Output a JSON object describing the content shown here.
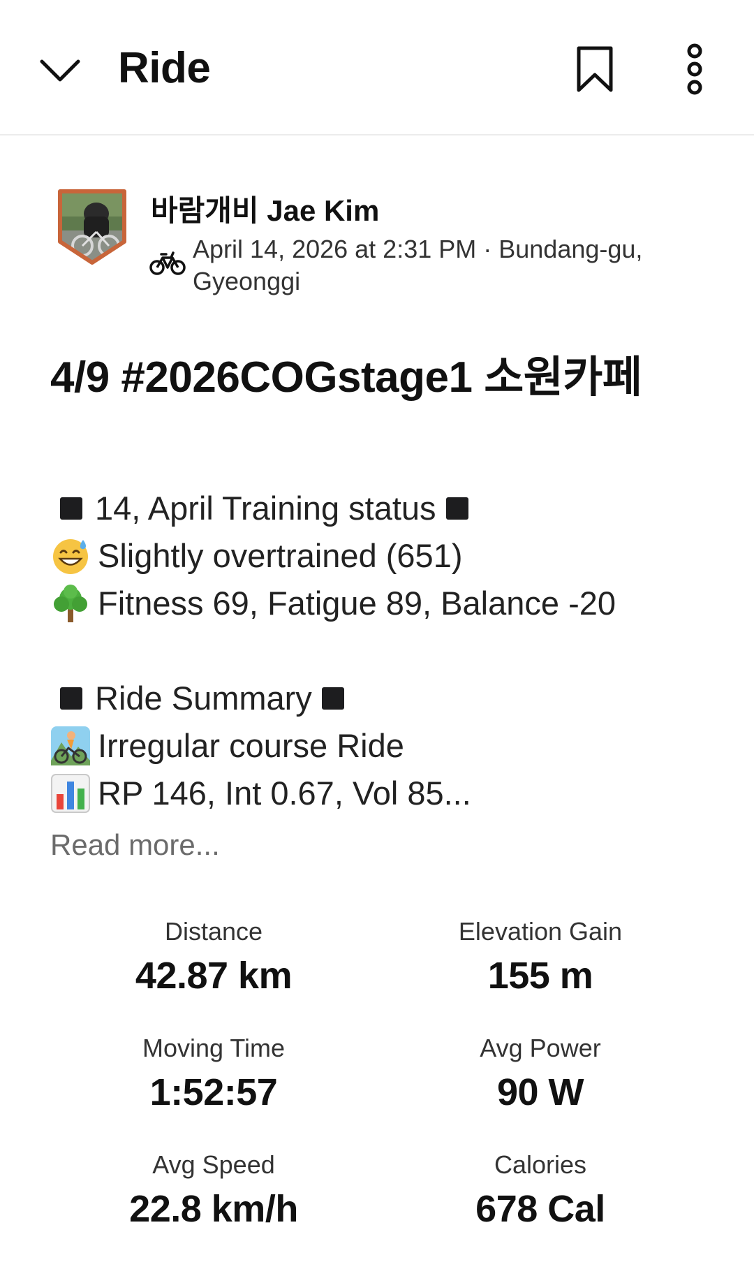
{
  "header": {
    "title": "Ride"
  },
  "athlete": {
    "name": "바람개비 Jae Kim",
    "activity_meta": "April 14, 2026 at 2:31 PM · Bundang-gu, Gyeonggi"
  },
  "activity": {
    "title": "4/9 #2026COGstage1 소원카페",
    "description": {
      "training_status_header": "14, April Training status",
      "status_line": "Slightly overtrained (651)",
      "fitness_line": "Fitness 69, Fatigue 89, Balance -20",
      "ride_summary_header": "Ride Summary",
      "course_line": "Irregular course Ride",
      "metrics_line": "RP 146, Int 0.67, Vol 85..."
    },
    "read_more": "Read more..."
  },
  "stats": [
    {
      "label": "Distance",
      "value": "42.87 km"
    },
    {
      "label": "Elevation Gain",
      "value": "155 m"
    },
    {
      "label": "Moving Time",
      "value": "1:52:57"
    },
    {
      "label": "Avg Power",
      "value": "90 W"
    },
    {
      "label": "Avg Speed",
      "value": "22.8 km/h"
    },
    {
      "label": "Calories",
      "value": "678 Cal"
    }
  ],
  "icons": {
    "back": "chevron-down-icon",
    "bookmark": "bookmark-icon",
    "more": "more-vertical-icon",
    "sport": "bicycle-icon"
  },
  "colors": {
    "avatar_border": "#c8653a",
    "muted_text": "#6b6b6b"
  }
}
